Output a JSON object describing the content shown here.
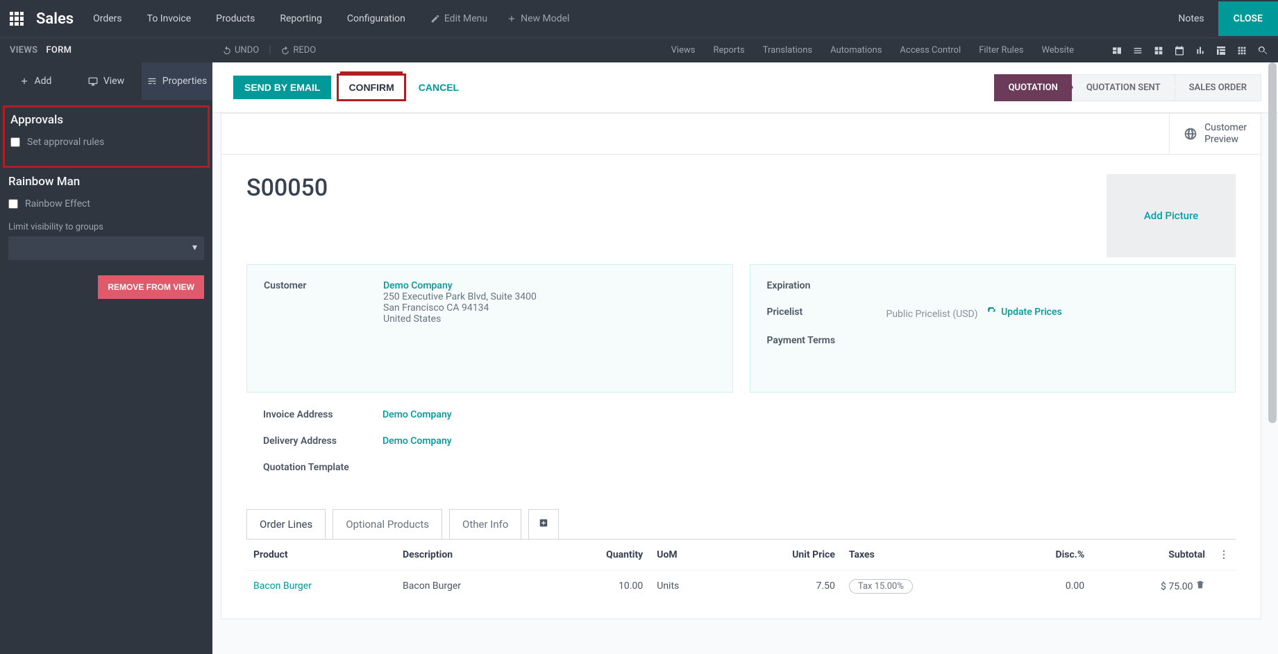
{
  "top": {
    "brand": "Sales",
    "menu": [
      "Orders",
      "To Invoice",
      "Products",
      "Reporting",
      "Configuration"
    ],
    "edit_menu": "Edit Menu",
    "new_model": "New Model",
    "notes": "Notes",
    "close": "CLOSE"
  },
  "subbar": {
    "views_label": "VIEWS",
    "form_label": "FORM",
    "undo": "UNDO",
    "redo": "REDO",
    "links": [
      "Views",
      "Reports",
      "Translations",
      "Automations",
      "Access Control",
      "Filter Rules",
      "Website"
    ]
  },
  "sidebar": {
    "tabs": {
      "add": "Add",
      "view": "View",
      "props": "Properties"
    },
    "approvals_heading": "Approvals",
    "approval_checkbox": "Set approval rules",
    "rainbow_heading": "Rainbow Man",
    "rainbow_checkbox": "Rainbow Effect",
    "limit_label": "Limit visibility to groups",
    "remove_btn": "REMOVE FROM VIEW"
  },
  "actions": {
    "send_email": "SEND BY EMAIL",
    "confirm": "CONFIRM",
    "cancel": "CANCEL",
    "steps": [
      "QUOTATION",
      "QUOTATION SENT",
      "SALES ORDER"
    ]
  },
  "sheet": {
    "customer_preview": "Customer Preview",
    "order_no": "S00050",
    "add_picture": "Add Picture",
    "left": {
      "customer_label": "Customer",
      "customer_name": "Demo Company",
      "addr1": "250 Executive Park Blvd, Suite 3400",
      "addr2": "San Francisco CA 94134",
      "addr3": "United States",
      "invoice_label": "Invoice Address",
      "invoice_val": "Demo Company",
      "delivery_label": "Delivery Address",
      "delivery_val": "Demo Company",
      "template_label": "Quotation Template"
    },
    "right": {
      "expiration_label": "Expiration",
      "pricelist_label": "Pricelist",
      "pricelist_val": "Public Pricelist (USD)",
      "update_prices": "Update Prices",
      "payment_label": "Payment Terms"
    },
    "tabs": [
      "Order Lines",
      "Optional Products",
      "Other Info"
    ]
  },
  "table": {
    "headers": {
      "product": "Product",
      "description": "Description",
      "qty": "Quantity",
      "uom": "UoM",
      "unit_price": "Unit Price",
      "taxes": "Taxes",
      "disc": "Disc.%",
      "subtotal": "Subtotal"
    },
    "rows": [
      {
        "product": "Bacon Burger",
        "desc": "Bacon Burger",
        "qty": "10.00",
        "uom": "Units",
        "price": "7.50",
        "tax": "Tax 15.00%",
        "disc": "0.00",
        "subtotal": "$ 75.00"
      }
    ]
  }
}
